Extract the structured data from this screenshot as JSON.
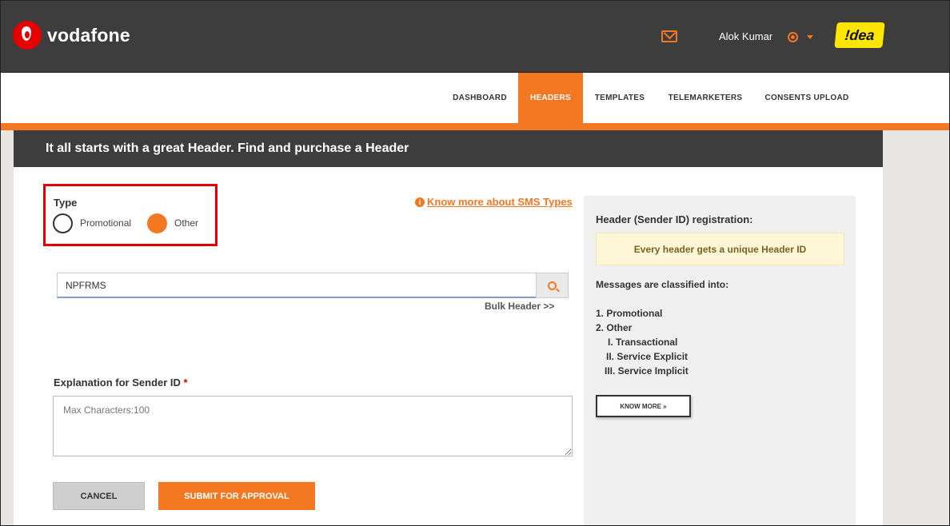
{
  "header": {
    "brand": "vodafone",
    "user_name": "Alok Kumar",
    "partner_logo": "!dea",
    "icons": {
      "mail": "mail-icon",
      "user": "user-circle-icon",
      "caret": "caret-down-icon"
    }
  },
  "nav": {
    "items": [
      {
        "label": "DASHBOARD",
        "active": false
      },
      {
        "label": "HEADERS",
        "active": true
      },
      {
        "label": "TEMPLATES",
        "active": false
      },
      {
        "label": "TELEMARKETERS",
        "active": false
      },
      {
        "label": "CONSENTS UPLOAD",
        "active": false
      }
    ]
  },
  "page": {
    "title": "It all starts with a great Header. Find and purchase a Header"
  },
  "form": {
    "type_label": "Type",
    "options": [
      {
        "label": "Promotional",
        "selected": false
      },
      {
        "label": "Other",
        "selected": true
      }
    ],
    "know_more_link": "Know more about SMS Types",
    "search_value": "NPFRMS",
    "bulk_link": "Bulk Header >>",
    "explanation_label": "Explanation for Sender ID",
    "required_mark": "*",
    "explanation_placeholder": "Max Characters:100",
    "cancel_label": "CANCEL",
    "submit_label": "SUBMIT FOR APPROVAL"
  },
  "panel": {
    "title": "Header (Sender ID) registration:",
    "note": "Every header gets a unique Header ID",
    "subtitle": "Messages are classified into:",
    "lines": [
      "1. Promotional",
      "2. Other",
      "I. Transactional",
      "II. Service Explicit",
      "III. Service Implicit"
    ],
    "button": "KNOW MORE »"
  },
  "colors": {
    "accent": "#f47721",
    "header_bg": "#3d3d3d",
    "highlight_box": "#e00000"
  }
}
